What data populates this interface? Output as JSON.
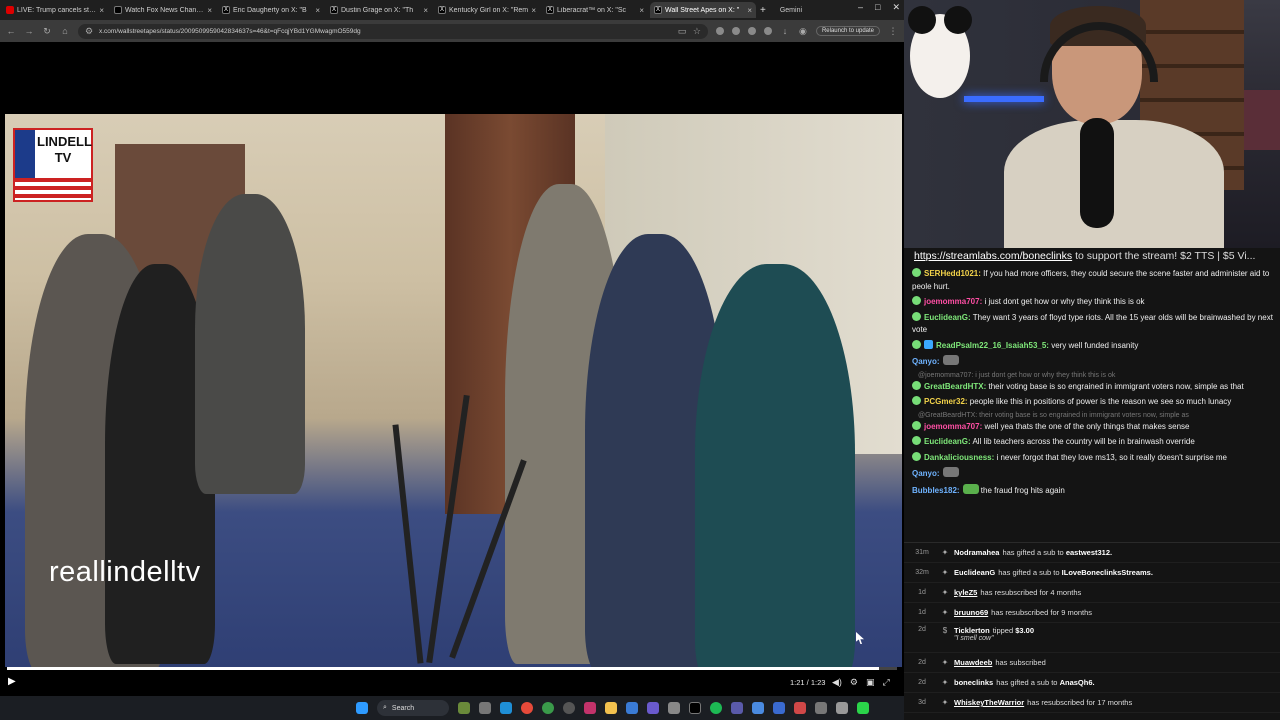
{
  "browser": {
    "tabs": [
      {
        "label": "LIVE: Trump cancels strike",
        "active": false
      },
      {
        "label": "Watch Fox News Channel",
        "active": false
      },
      {
        "label": "Eric Daugherty on X: \"B",
        "active": false
      },
      {
        "label": "Dustin Grage on X: \"Th",
        "active": false
      },
      {
        "label": "Kentucky Girl on X: \"Rem",
        "active": false
      },
      {
        "label": "Liberacrat™ on X: \"Sc",
        "active": false
      },
      {
        "label": "Wall Street Apes on X: \"",
        "active": true
      }
    ],
    "extra_tab": "Gemini",
    "url": "x.com/wallstreetapes/status/2009509959042834637s=46&t=qFcqjYBd1YGMwagmO559dg",
    "relaunch_label": "Relaunch to update"
  },
  "video": {
    "logo_line1": "LINDELL",
    "logo_line2": "TV",
    "watermark": "reallindelltv",
    "time": "1:21 / 1:23",
    "progress": 0.98
  },
  "taskbar": {
    "search_label": "Search"
  },
  "chat": {
    "banner_link": "https://streamlabs.com/boneclinks",
    "banner_text": " to support the stream! $2 TTS | $5 Vi...",
    "messages": [
      {
        "user": "SERHedd1021:",
        "cls": "u-yellow",
        "text": " If you had more officers, they could secure the scene faster and administer aid to peole hurt."
      },
      {
        "user": "joemomma707:",
        "cls": "u-pink",
        "text": " i just dont get how or why they think this is ok"
      },
      {
        "user": "EuclideanG:",
        "cls": "u-green",
        "text": " They want 3 years of floyd type riots. All the 15 year olds will be brainwashed by next vote"
      },
      {
        "user": "ReadPsalm22_16_Isaiah53_5:",
        "cls": "u-green",
        "text": " very well funded insanity"
      },
      {
        "user": "Qanyo:",
        "cls": "u-blue",
        "text": ""
      },
      {
        "user": "GreatBeardHTX:",
        "cls": "u-green",
        "text": " their voting base is so engrained in immigrant voters now, simple as that"
      },
      {
        "user": "PCGmer32:",
        "cls": "u-yellow",
        "text": " people like this in positions of power is the reason we see so much lunacy"
      },
      {
        "user": "joemomma707:",
        "cls": "u-pink",
        "text": " well yea thats the one of the only things that makes sense"
      },
      {
        "user": "EuclideanG:",
        "cls": "u-green",
        "text": " All lib teachers across the country will be in brainwash override"
      },
      {
        "user": "Dankaliciousness:",
        "cls": "u-green",
        "text": " i never forgot that they love ms13, so it really doesn't surprise me"
      },
      {
        "user": "Qanyo:",
        "cls": "u-blue",
        "text": ""
      },
      {
        "user": "Bubbles182:",
        "cls": "u-blue",
        "text": " the fraud frog hits again"
      }
    ],
    "replies": [
      "@joemomma707: i just dont get how or why they think this is ok",
      "@GreatBeardHTX: their voting base is so engrained in immigrant voters now, simple as"
    ],
    "events": [
      {
        "time": "31m",
        "who": "Nodramahea",
        "text": "has gifted a sub to",
        "target": "eastwest312."
      },
      {
        "time": "32m",
        "who": "EuclideanG",
        "text": "has gifted a sub to",
        "target": "ILoveBoneclinksStreams."
      },
      {
        "time": "1d",
        "who": "kyleZ5",
        "text": "has resubscribed for 4 months",
        "target": ""
      },
      {
        "time": "1d",
        "who": "bruuno69",
        "text": "has resubscribed for 9 months",
        "target": ""
      },
      {
        "time": "2d",
        "who": "Ticklerton",
        "text": "tipped",
        "target": "$3.00",
        "quote": "\"I smell cow\""
      },
      {
        "time": "2d",
        "who": "Muawdeeb",
        "text": "has subscribed",
        "target": ""
      },
      {
        "time": "2d",
        "who": "boneclinks",
        "text": "has gifted a sub to",
        "target": "AnasQh6."
      },
      {
        "time": "3d",
        "who": "WhiskeyTheWarrior",
        "text": "has resubscribed for 17 months",
        "target": ""
      }
    ]
  }
}
